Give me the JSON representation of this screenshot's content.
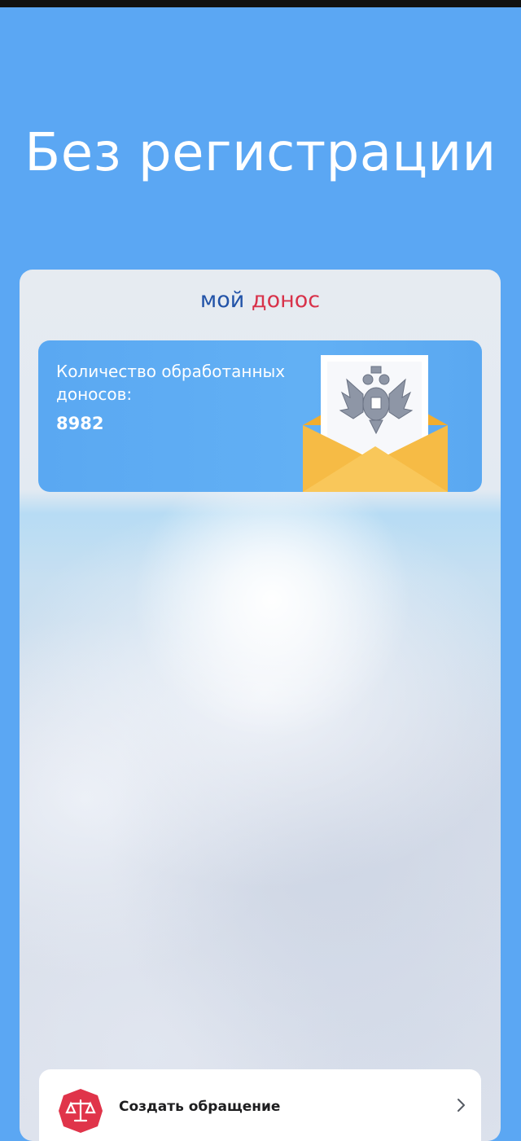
{
  "promo": {
    "title": "Без регистрации"
  },
  "app": {
    "brand_part1": "мой",
    "brand_part2": "донос"
  },
  "counter_card": {
    "label": "Количество обработанных доносов:",
    "value": "8982"
  },
  "actions": {
    "create_label": "Создать обращение"
  },
  "icons": {
    "envelope": "envelope-with-emblem-icon",
    "create": "scales-of-justice-icon",
    "chevron": "chevron-right-icon"
  },
  "colors": {
    "background": "#5ba7f3",
    "brand_blue": "#2253a8",
    "brand_red": "#d8324a",
    "card_blue": "#5aa8f2",
    "envelope_yellow": "#f5b940",
    "icon_red": "#e0344a"
  }
}
